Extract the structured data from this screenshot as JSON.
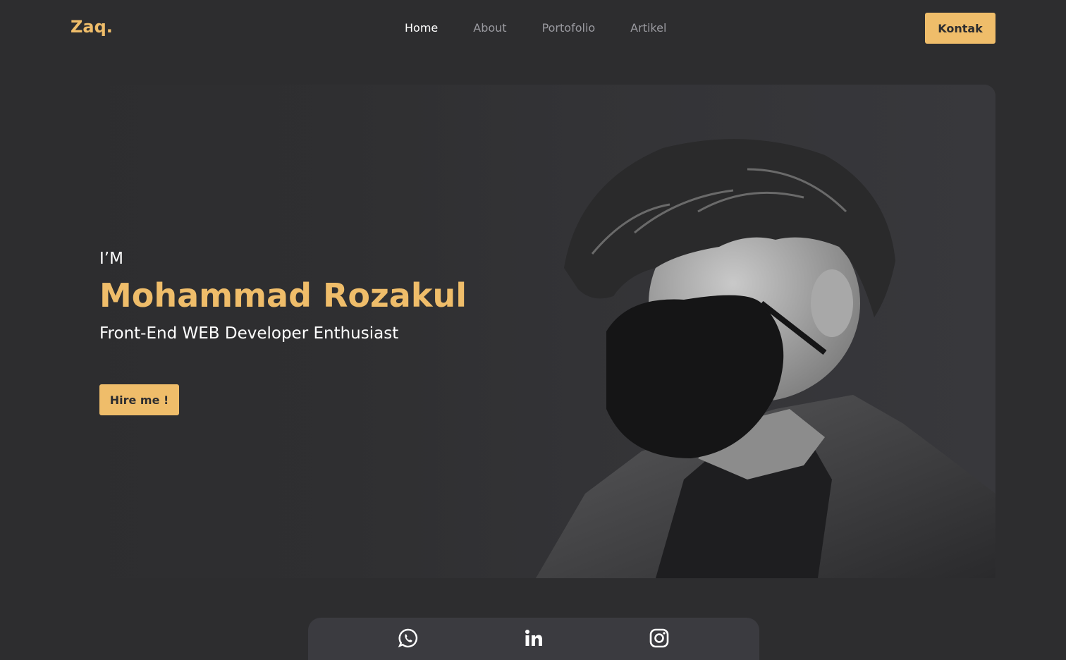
{
  "nav": {
    "logo": "Zaq.",
    "links": [
      "Home",
      "About",
      "Portofolio",
      "Artikel"
    ],
    "active": "Home",
    "cta": "Kontak"
  },
  "hero": {
    "intro": "I’M",
    "name": "Mohammad Rozakul",
    "tagline": "Front-End WEB Developer Enthusiast",
    "button": "Hire me !",
    "photo_icon": "profile-photo"
  },
  "social": {
    "icons": [
      "whatsapp-icon",
      "linkedin-icon",
      "instagram-icon"
    ]
  },
  "colors": {
    "background": "#2d2d2f",
    "accent": "#efbd6a",
    "card": "#3b3b40",
    "muted_text": "#9a9aa0"
  }
}
